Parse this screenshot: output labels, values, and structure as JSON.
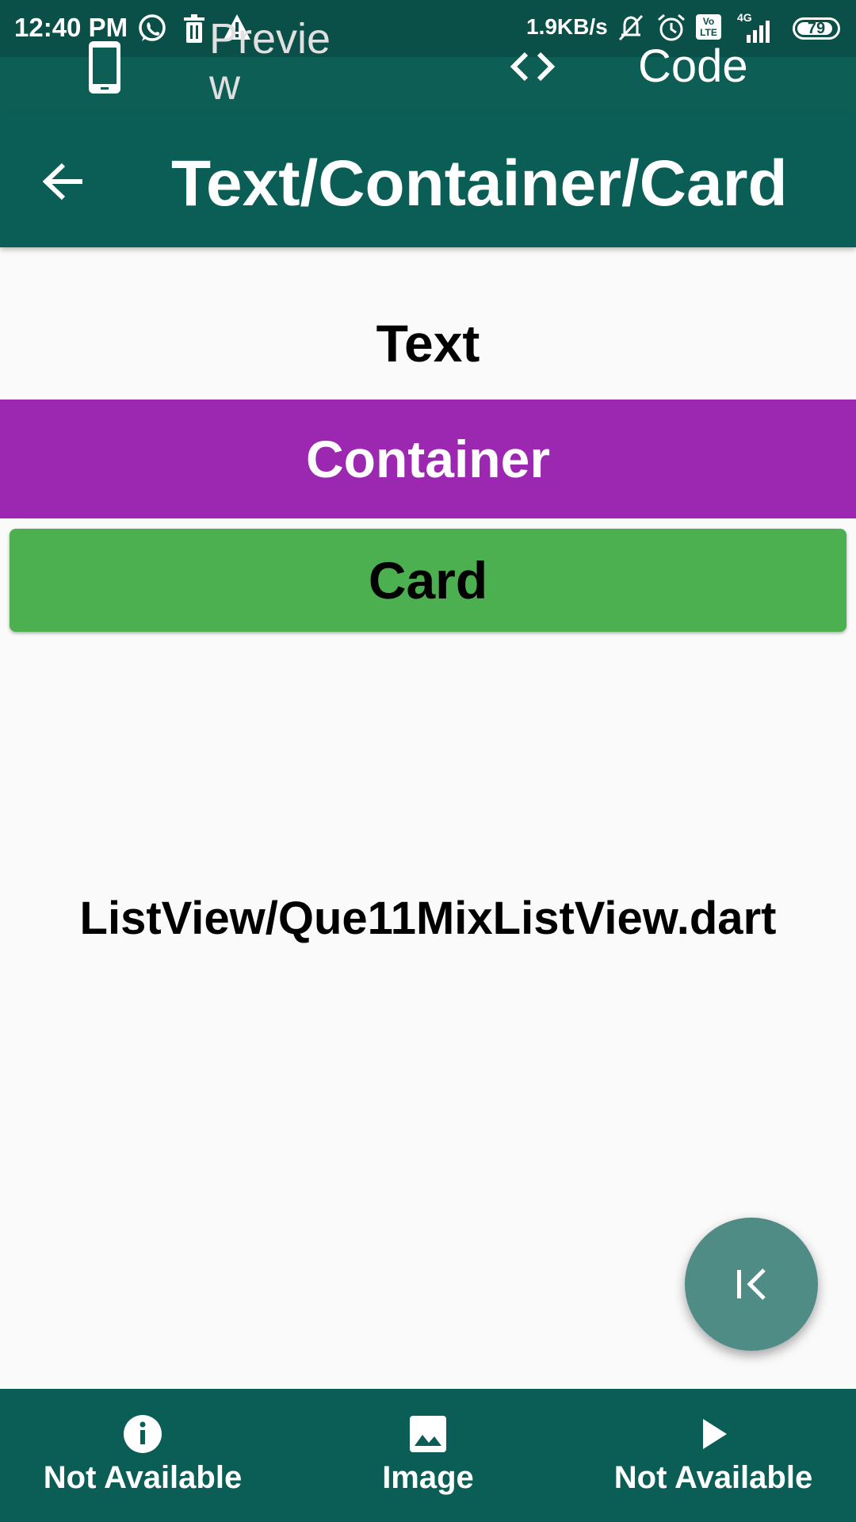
{
  "status_bar": {
    "time": "12:40 PM",
    "network_speed": "1.9KB/s",
    "network_type": "4G",
    "volte": "Vo LTE",
    "battery": "79",
    "icons": [
      "whatsapp-icon",
      "delete-icon",
      "warning-icon",
      "mute-icon",
      "alarm-icon",
      "volte-icon",
      "signal-icon",
      "battery-icon"
    ]
  },
  "tab_bar": {
    "preview_label": "Preview",
    "code_label": "Code",
    "icons": [
      "phone-icon",
      "code-brackets-icon"
    ]
  },
  "app_bar": {
    "title": "Text/Container/Card",
    "back_icon": "arrow-back-icon"
  },
  "content": {
    "text_label": "Text",
    "container_label": "Container",
    "container_color": "#9c27b0",
    "card_label": "Card",
    "card_color": "#4caf50",
    "file_path": "ListView/Que11MixListView.dart"
  },
  "fab": {
    "icon": "first-page-icon"
  },
  "bottom_nav": {
    "items": [
      {
        "label": "Not Available",
        "icon": "info-icon"
      },
      {
        "label": "Image",
        "icon": "image-icon"
      },
      {
        "label": "Not Available",
        "icon": "play-icon"
      }
    ]
  },
  "colors": {
    "primary": "#0b5e56",
    "status_bar": "#0a4f48",
    "fab": "#4f8c85",
    "background": "#fafafa"
  }
}
